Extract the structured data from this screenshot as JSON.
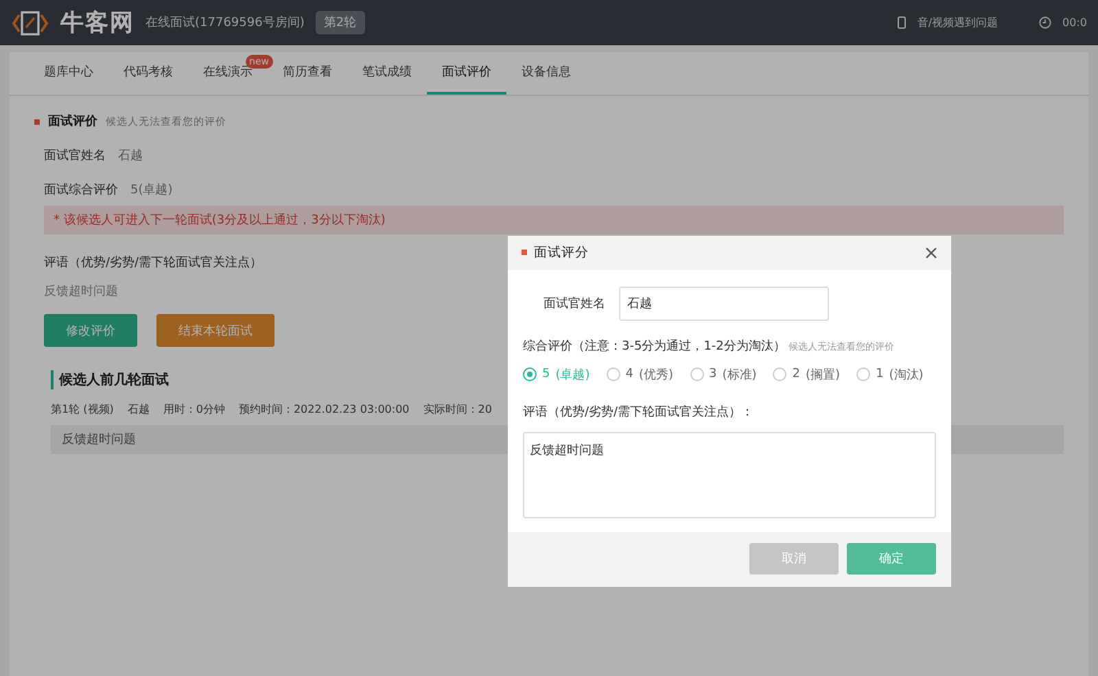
{
  "header": {
    "logo": "牛客网",
    "room": "在线面试(17769596号房间)",
    "round_badge": "第2轮",
    "help": "音/视频遇到问题",
    "timer": "00:0"
  },
  "tabs": [
    {
      "label": "题库中心",
      "selected": false
    },
    {
      "label": "代码考核",
      "selected": false
    },
    {
      "label": "在线演示",
      "selected": false,
      "badge": "new"
    },
    {
      "label": "简历查看",
      "selected": false
    },
    {
      "label": "笔试成绩",
      "selected": false
    },
    {
      "label": "面试评价",
      "selected": true
    },
    {
      "label": "设备信息",
      "selected": false
    }
  ],
  "evaluation": {
    "title": "面试评价",
    "hint": "候选人无法查看您的评价",
    "fields": [
      {
        "label": "面试官姓名",
        "value": "石越"
      },
      {
        "label": "面试综合评价",
        "value": "5(卓越)"
      }
    ],
    "notice": "* 该候选人可进入下一轮面试(3分及以上通过，3分以下淘汰)",
    "comment_label": "评语（优势/劣势/需下轮面试官关注点）",
    "comment": "反馈超时问题",
    "buttons": [
      {
        "label": "修改评价",
        "kind": "primary"
      },
      {
        "label": "结束本轮面试",
        "kind": "warning"
      }
    ]
  },
  "previous": {
    "title": "候选人前几轮面试",
    "rounds": [
      {
        "cells": [
          "第1轮 (视频)",
          "石越",
          "用时：0分钟",
          "预约时间：2022.02.23 03:00:00",
          "实际时间：20"
        ],
        "feedback": "反馈超时问题"
      }
    ]
  },
  "modal": {
    "title": "面试评分",
    "name_label": "面试官姓名",
    "name_value": "石越",
    "rating_label": "综合评价（注意：3-5分为通过，1-2分为淘汰）",
    "rating_hint": "候选人无法查看您的评价",
    "options": [
      {
        "score": "5",
        "label": "(卓越)",
        "selected": true
      },
      {
        "score": "4",
        "label": "(优秀)",
        "selected": false
      },
      {
        "score": "3",
        "label": "(标准)",
        "selected": false
      },
      {
        "score": "2",
        "label": "(搁置)",
        "selected": false
      },
      {
        "score": "1",
        "label": "(淘汰)",
        "selected": false
      }
    ],
    "comment_label": "评语（优势/劣势/需下轮面试官关注点）：",
    "comment": "反馈超时问题",
    "buttons": [
      {
        "label": "取消",
        "kind": "secondary"
      },
      {
        "label": "确定",
        "kind": "primary"
      }
    ]
  }
}
